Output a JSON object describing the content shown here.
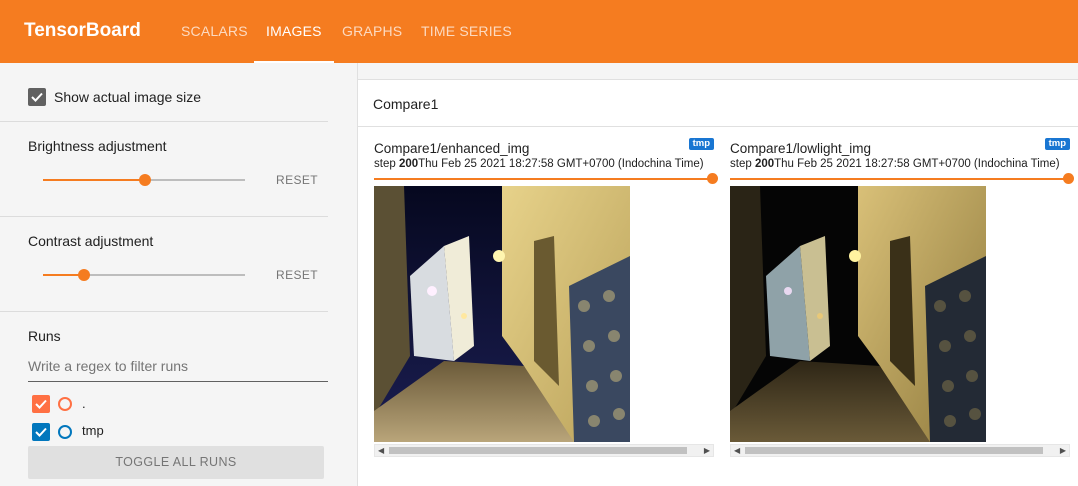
{
  "app": {
    "title": "TensorBoard",
    "accent_color": "#f57c20",
    "tabs": [
      {
        "label": "SCALARS",
        "active": false
      },
      {
        "label": "IMAGES",
        "active": true
      },
      {
        "label": "GRAPHS",
        "active": false
      },
      {
        "label": "TIME SERIES",
        "active": false
      }
    ]
  },
  "sidebar": {
    "show_actual_size": {
      "label": "Show actual image size",
      "checked": true
    },
    "brightness": {
      "label": "Brightness adjustment",
      "value_fraction": 0.5,
      "reset_label": "RESET"
    },
    "contrast": {
      "label": "Contrast adjustment",
      "value_fraction": 0.2,
      "reset_label": "RESET"
    },
    "runs": {
      "heading": "Runs",
      "filter_placeholder": "Write a regex to filter runs",
      "items": [
        {
          "name": ".",
          "checked": true,
          "color": "#ff7043"
        },
        {
          "name": "tmp",
          "checked": true,
          "color": "#0277bd"
        }
      ],
      "toggle_all_label": "TOGGLE ALL RUNS"
    }
  },
  "main": {
    "group_title": "Compare1",
    "cards": [
      {
        "title": "Compare1/enhanced_img",
        "run_badge": "tmp",
        "step_label": "step",
        "step": "200",
        "timestamp": "Thu Feb 25 2021 18:27:58 GMT+0700 (Indochina Time)",
        "image_icon": "night-street-photo-enhanced"
      },
      {
        "title": "Compare1/lowlight_img",
        "run_badge": "tmp",
        "step_label": "step",
        "step": "200",
        "timestamp": "Thu Feb 25 2021 18:27:58 GMT+0700 (Indochina Time)",
        "image_icon": "night-street-photo-lowlight"
      }
    ]
  }
}
